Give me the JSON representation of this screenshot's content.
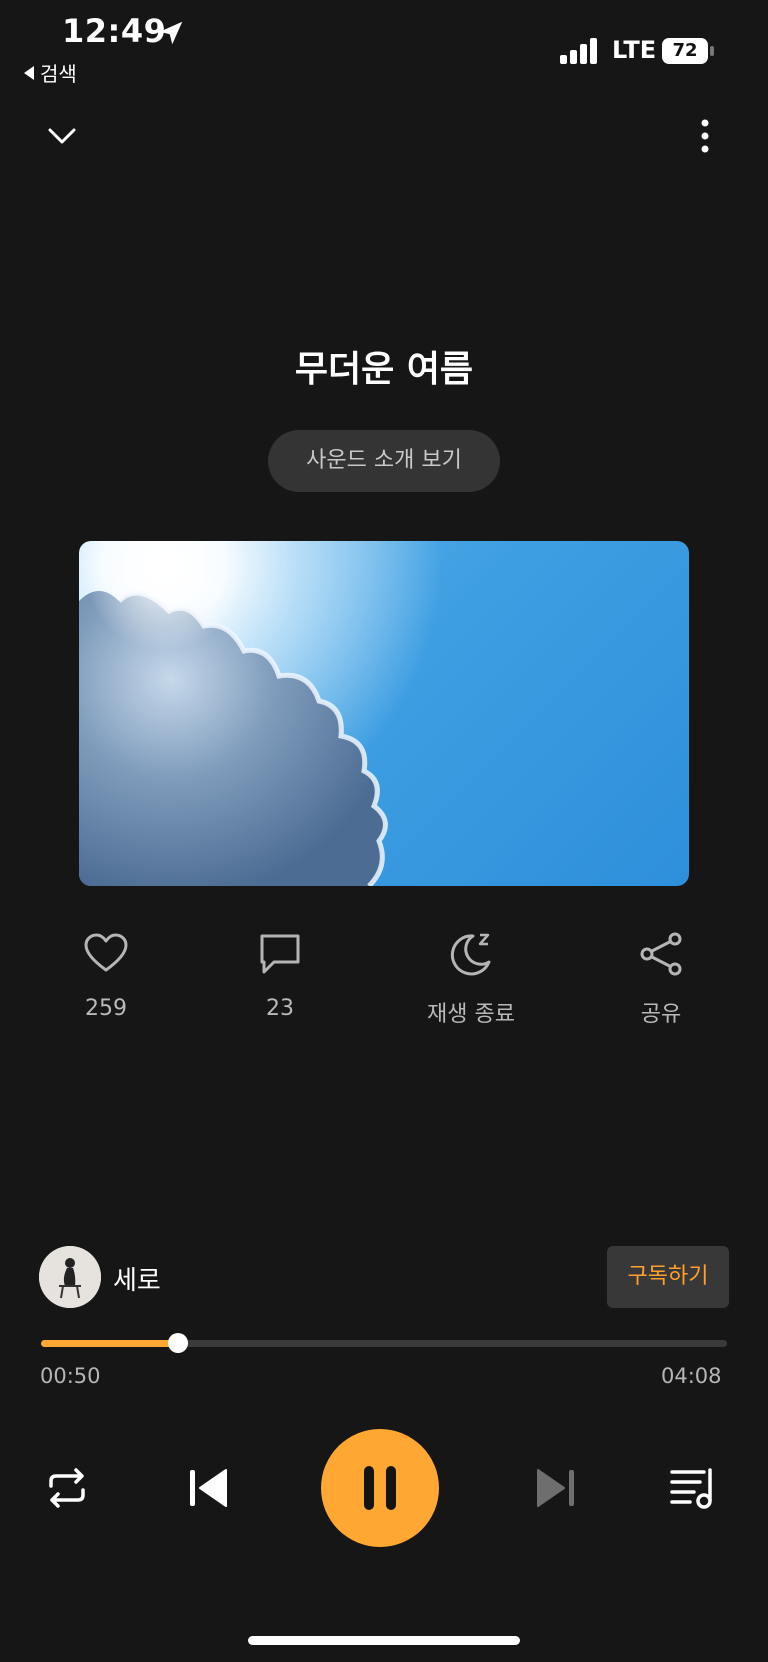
{
  "status_bar": {
    "time": "12:49",
    "back_label": "검색",
    "network": "LTE",
    "battery": "72"
  },
  "header": {
    "collapse_icon": "chevron-down-icon",
    "more_icon": "more-vertical-icon"
  },
  "sound": {
    "title": "무더운 여름",
    "intro_button": "사운드 소개 보기"
  },
  "actions": {
    "likes": "259",
    "comments": "23",
    "sleep_timer": "재생 종료",
    "share": "공유"
  },
  "channel": {
    "name": "세로",
    "subscribe": "구독하기"
  },
  "playback": {
    "current_time": "00:50",
    "total_time": "04:08",
    "progress": 0.2
  },
  "colors": {
    "accent": "#ffa733",
    "background": "#161616"
  }
}
